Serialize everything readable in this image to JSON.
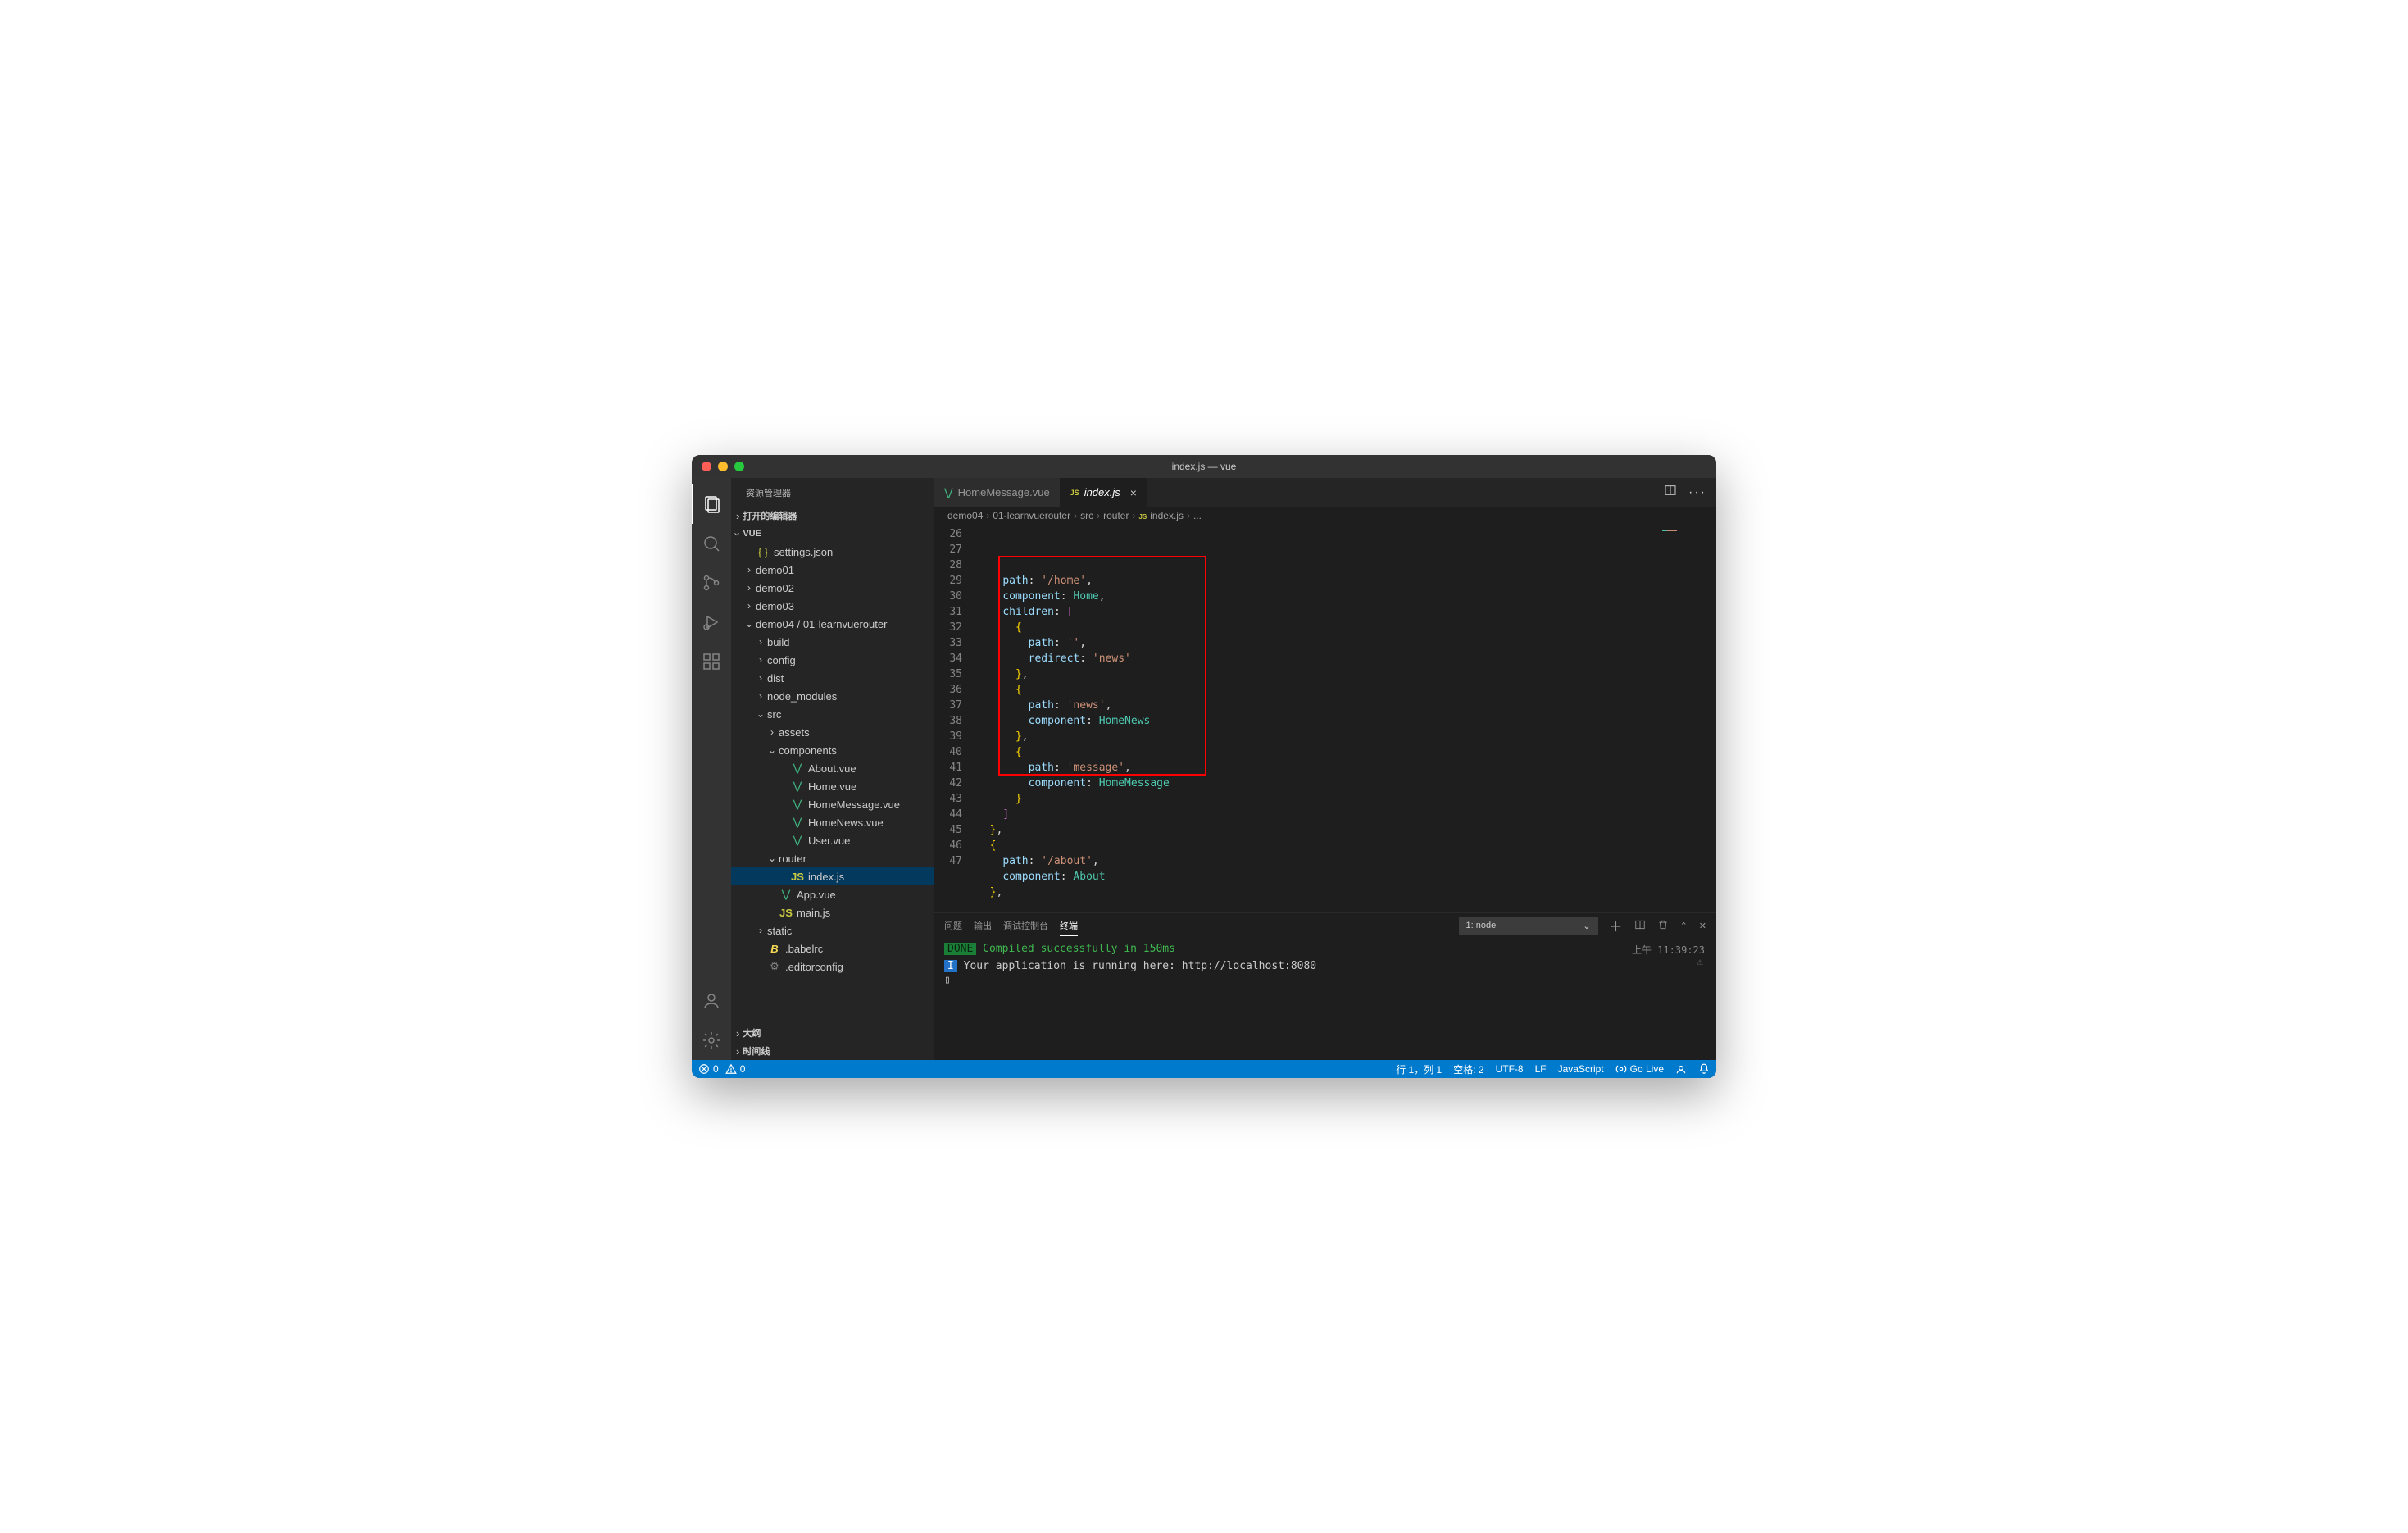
{
  "title": "index.js — vue",
  "sidebar": {
    "title": "资源管理器",
    "sections": {
      "openEditors": "打开的编辑器",
      "project": "VUE",
      "outline": "大纲",
      "timeline": "时间线"
    },
    "tree": [
      {
        "depth": 0,
        "type": "file",
        "icon": "json",
        "label": "settings.json"
      },
      {
        "depth": 0,
        "type": "folder",
        "open": false,
        "label": "demo01"
      },
      {
        "depth": 0,
        "type": "folder",
        "open": false,
        "label": "demo02"
      },
      {
        "depth": 0,
        "type": "folder",
        "open": false,
        "label": "demo03"
      },
      {
        "depth": 0,
        "type": "folder",
        "open": true,
        "label": "demo04 / 01-learnvuerouter"
      },
      {
        "depth": 1,
        "type": "folder",
        "open": false,
        "label": "build"
      },
      {
        "depth": 1,
        "type": "folder",
        "open": false,
        "label": "config"
      },
      {
        "depth": 1,
        "type": "folder",
        "open": false,
        "label": "dist"
      },
      {
        "depth": 1,
        "type": "folder",
        "open": false,
        "label": "node_modules"
      },
      {
        "depth": 1,
        "type": "folder",
        "open": true,
        "label": "src"
      },
      {
        "depth": 2,
        "type": "folder",
        "open": false,
        "label": "assets"
      },
      {
        "depth": 2,
        "type": "folder",
        "open": true,
        "label": "components"
      },
      {
        "depth": 3,
        "type": "file",
        "icon": "vue",
        "label": "About.vue"
      },
      {
        "depth": 3,
        "type": "file",
        "icon": "vue",
        "label": "Home.vue"
      },
      {
        "depth": 3,
        "type": "file",
        "icon": "vue",
        "label": "HomeMessage.vue"
      },
      {
        "depth": 3,
        "type": "file",
        "icon": "vue",
        "label": "HomeNews.vue"
      },
      {
        "depth": 3,
        "type": "file",
        "icon": "vue",
        "label": "User.vue"
      },
      {
        "depth": 2,
        "type": "folder",
        "open": true,
        "label": "router"
      },
      {
        "depth": 3,
        "type": "file",
        "icon": "js",
        "label": "index.js",
        "selected": true
      },
      {
        "depth": 2,
        "type": "file",
        "icon": "vue",
        "label": "App.vue"
      },
      {
        "depth": 2,
        "type": "file",
        "icon": "js",
        "label": "main.js"
      },
      {
        "depth": 1,
        "type": "folder",
        "open": false,
        "label": "static"
      },
      {
        "depth": 1,
        "type": "file",
        "icon": "babel",
        "label": ".babelrc"
      },
      {
        "depth": 1,
        "type": "file",
        "icon": "gear",
        "label": ".editorconfig"
      }
    ]
  },
  "tabs": [
    {
      "icon": "vue",
      "label": "HomeMessage.vue",
      "active": false
    },
    {
      "icon": "js",
      "label": "index.js",
      "active": true,
      "close": true
    }
  ],
  "breadcrumbs": [
    "demo04",
    "01-learnvuerouter",
    "src",
    "router",
    "index.js",
    "..."
  ],
  "breadcrumb_file_icon": "js",
  "editor": {
    "startLine": 26,
    "lines": [
      [
        [
          "    ",
          null
        ],
        [
          "path",
          1
        ],
        [
          ": ",
          0
        ],
        [
          "'/home'",
          2
        ],
        [
          ",",
          0
        ]
      ],
      [
        [
          "    ",
          null
        ],
        [
          "component",
          1
        ],
        [
          ": ",
          0
        ],
        [
          "Home",
          3
        ],
        [
          ",",
          0
        ]
      ],
      [
        [
          "    ",
          null
        ],
        [
          "children",
          1
        ],
        [
          ": ",
          0
        ],
        [
          "[",
          4
        ]
      ],
      [
        [
          "      ",
          null
        ],
        [
          "{",
          5
        ]
      ],
      [
        [
          "        ",
          null
        ],
        [
          "path",
          1
        ],
        [
          ": ",
          0
        ],
        [
          "''",
          2
        ],
        [
          ",",
          0
        ]
      ],
      [
        [
          "        ",
          null
        ],
        [
          "redirect",
          1
        ],
        [
          ": ",
          0
        ],
        [
          "'news'",
          2
        ]
      ],
      [
        [
          "      ",
          null
        ],
        [
          "}",
          5
        ],
        [
          ",",
          0
        ]
      ],
      [
        [
          "      ",
          null
        ],
        [
          "{",
          5
        ]
      ],
      [
        [
          "        ",
          null
        ],
        [
          "path",
          1
        ],
        [
          ": ",
          0
        ],
        [
          "'news'",
          2
        ],
        [
          ",",
          0
        ]
      ],
      [
        [
          "        ",
          null
        ],
        [
          "component",
          1
        ],
        [
          ": ",
          0
        ],
        [
          "HomeNews",
          3
        ]
      ],
      [
        [
          "      ",
          null
        ],
        [
          "}",
          5
        ],
        [
          ",",
          0
        ]
      ],
      [
        [
          "      ",
          null
        ],
        [
          "{",
          5
        ]
      ],
      [
        [
          "        ",
          null
        ],
        [
          "path",
          1
        ],
        [
          ": ",
          0
        ],
        [
          "'message'",
          2
        ],
        [
          ",",
          0
        ]
      ],
      [
        [
          "        ",
          null
        ],
        [
          "component",
          1
        ],
        [
          ": ",
          0
        ],
        [
          "HomeMessage",
          3
        ]
      ],
      [
        [
          "      ",
          null
        ],
        [
          "}",
          5
        ]
      ],
      [
        [
          "    ",
          null
        ],
        [
          "]",
          4
        ]
      ],
      [
        [
          "  ",
          null
        ],
        [
          "}",
          5
        ],
        [
          ",",
          0
        ]
      ],
      [
        [
          "  ",
          null
        ],
        [
          "{",
          5
        ]
      ],
      [
        [
          "    ",
          null
        ],
        [
          "path",
          1
        ],
        [
          ": ",
          0
        ],
        [
          "'/about'",
          2
        ],
        [
          ",",
          0
        ]
      ],
      [
        [
          "    ",
          null
        ],
        [
          "component",
          1
        ],
        [
          ": ",
          0
        ],
        [
          "About",
          3
        ]
      ],
      [
        [
          "  ",
          null
        ],
        [
          "}",
          5
        ],
        [
          ",",
          0
        ]
      ],
      [
        [
          "  ",
          null
        ]
      ]
    ],
    "highlightBox": {
      "fromLine": 28,
      "toLine": 41
    }
  },
  "panel": {
    "tabs": [
      "问题",
      "输出",
      "调试控制台",
      "终端"
    ],
    "activeTab": 3,
    "terminalSelect": "1: node",
    "timestamp": "上午 11:39:23",
    "doneLabel": "DONE",
    "doneText": "Compiled successfully in 150ms",
    "infoPrefix": "I",
    "infoText": "Your application is running here: http://localhost:8080"
  },
  "statusbar": {
    "errors": "0",
    "warnings": "0",
    "lineCol": "行 1，列 1",
    "spaces": "空格: 2",
    "encoding": "UTF-8",
    "eol": "LF",
    "lang": "JavaScript",
    "golive": "Go Live"
  }
}
